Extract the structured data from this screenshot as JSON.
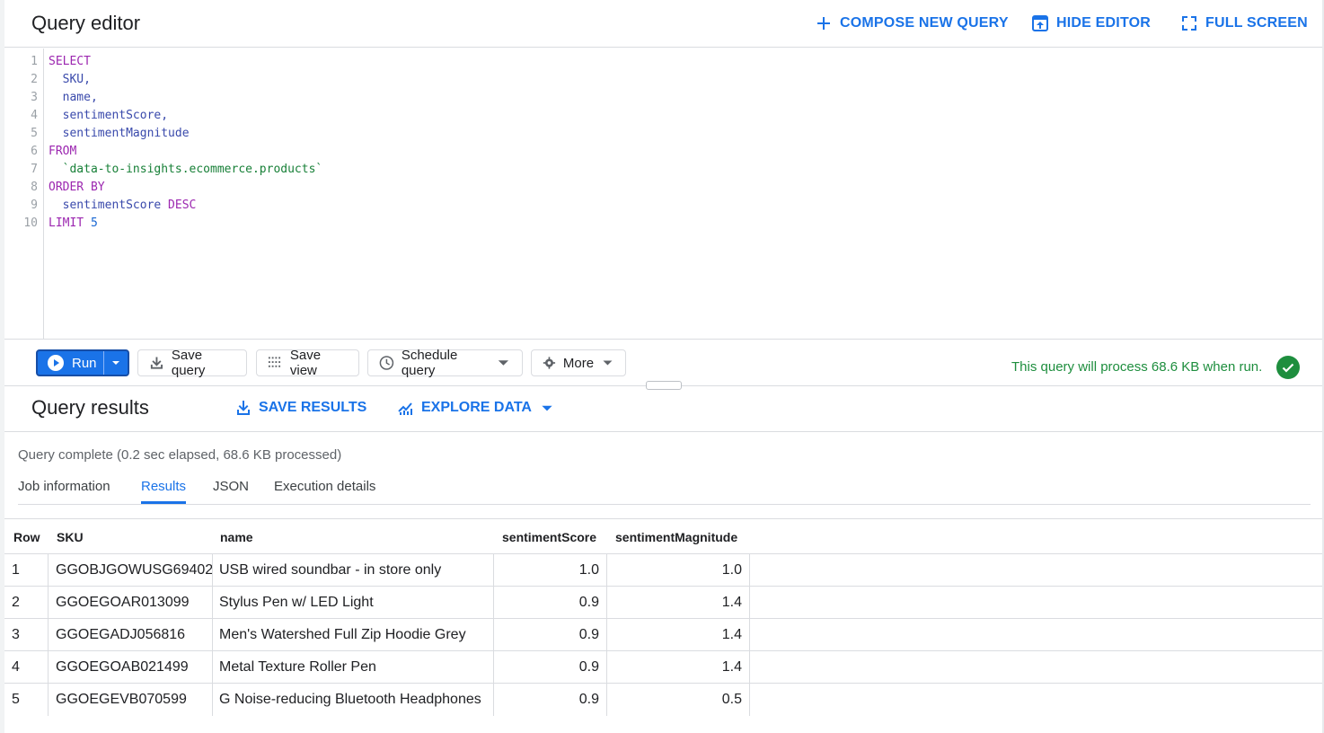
{
  "editor": {
    "title": "Query editor",
    "compose_label": "COMPOSE NEW QUERY",
    "hide_label": "HIDE EDITOR",
    "fullscreen_label": "FULL SCREEN",
    "line_numbers": [
      "1",
      "2",
      "3",
      "4",
      "5",
      "6",
      "7",
      "8",
      "9",
      "10"
    ],
    "code": {
      "l1": "SELECT",
      "l2": "  SKU,",
      "l3": "  name,",
      "l4": "  sentimentScore,",
      "l5": "  sentimentMagnitude",
      "l6": "FROM",
      "l7": "  `data-to-insights.ecommerce.products`",
      "l8": "ORDER BY",
      "l9a": "  sentimentScore",
      "l9b": " DESC",
      "l10a": "LIMIT",
      "l10b": " 5"
    }
  },
  "toolbar": {
    "run_label": "Run",
    "save_query_label": "Save query",
    "save_view_label": "Save view",
    "schedule_label": "Schedule query",
    "more_label": "More",
    "estimate": "This query will process 68.6 KB when run."
  },
  "results": {
    "title": "Query results",
    "save_results_label": "SAVE RESULTS",
    "explore_label": "EXPLORE DATA",
    "status": "Query complete (0.2 sec elapsed, 68.6 KB processed)",
    "tabs": [
      "Job information",
      "Results",
      "JSON",
      "Execution details"
    ],
    "active_tab": "Results",
    "columns": [
      "Row",
      "SKU",
      "name",
      "sentimentScore",
      "sentimentMagnitude"
    ],
    "rows": [
      {
        "row": "1",
        "sku": "GGOBJGOWUSG69402",
        "name": "USB wired soundbar - in store only",
        "score": "1.0",
        "magnitude": "1.0"
      },
      {
        "row": "2",
        "sku": "GGOEGOAR013099",
        "name": " Stylus Pen w/ LED Light",
        "score": "0.9",
        "magnitude": "1.4"
      },
      {
        "row": "3",
        "sku": "GGOEGADJ056816",
        "name": " Men's Watershed Full Zip Hoodie Grey",
        "score": "0.9",
        "magnitude": "1.4"
      },
      {
        "row": "4",
        "sku": "GGOEGOAB021499",
        "name": "Metal Texture Roller Pen",
        "score": "0.9",
        "magnitude": "1.4"
      },
      {
        "row": "5",
        "sku": "GGOEGEVB070599",
        "name": " G Noise-reducing Bluetooth Headphones",
        "score": "0.9",
        "magnitude": "0.5"
      }
    ]
  },
  "colors": {
    "accent": "#1a73e8",
    "success": "#1e8e3e",
    "keyword": "#9c27b0",
    "identifier": "#3949ab",
    "string": "#188038"
  }
}
